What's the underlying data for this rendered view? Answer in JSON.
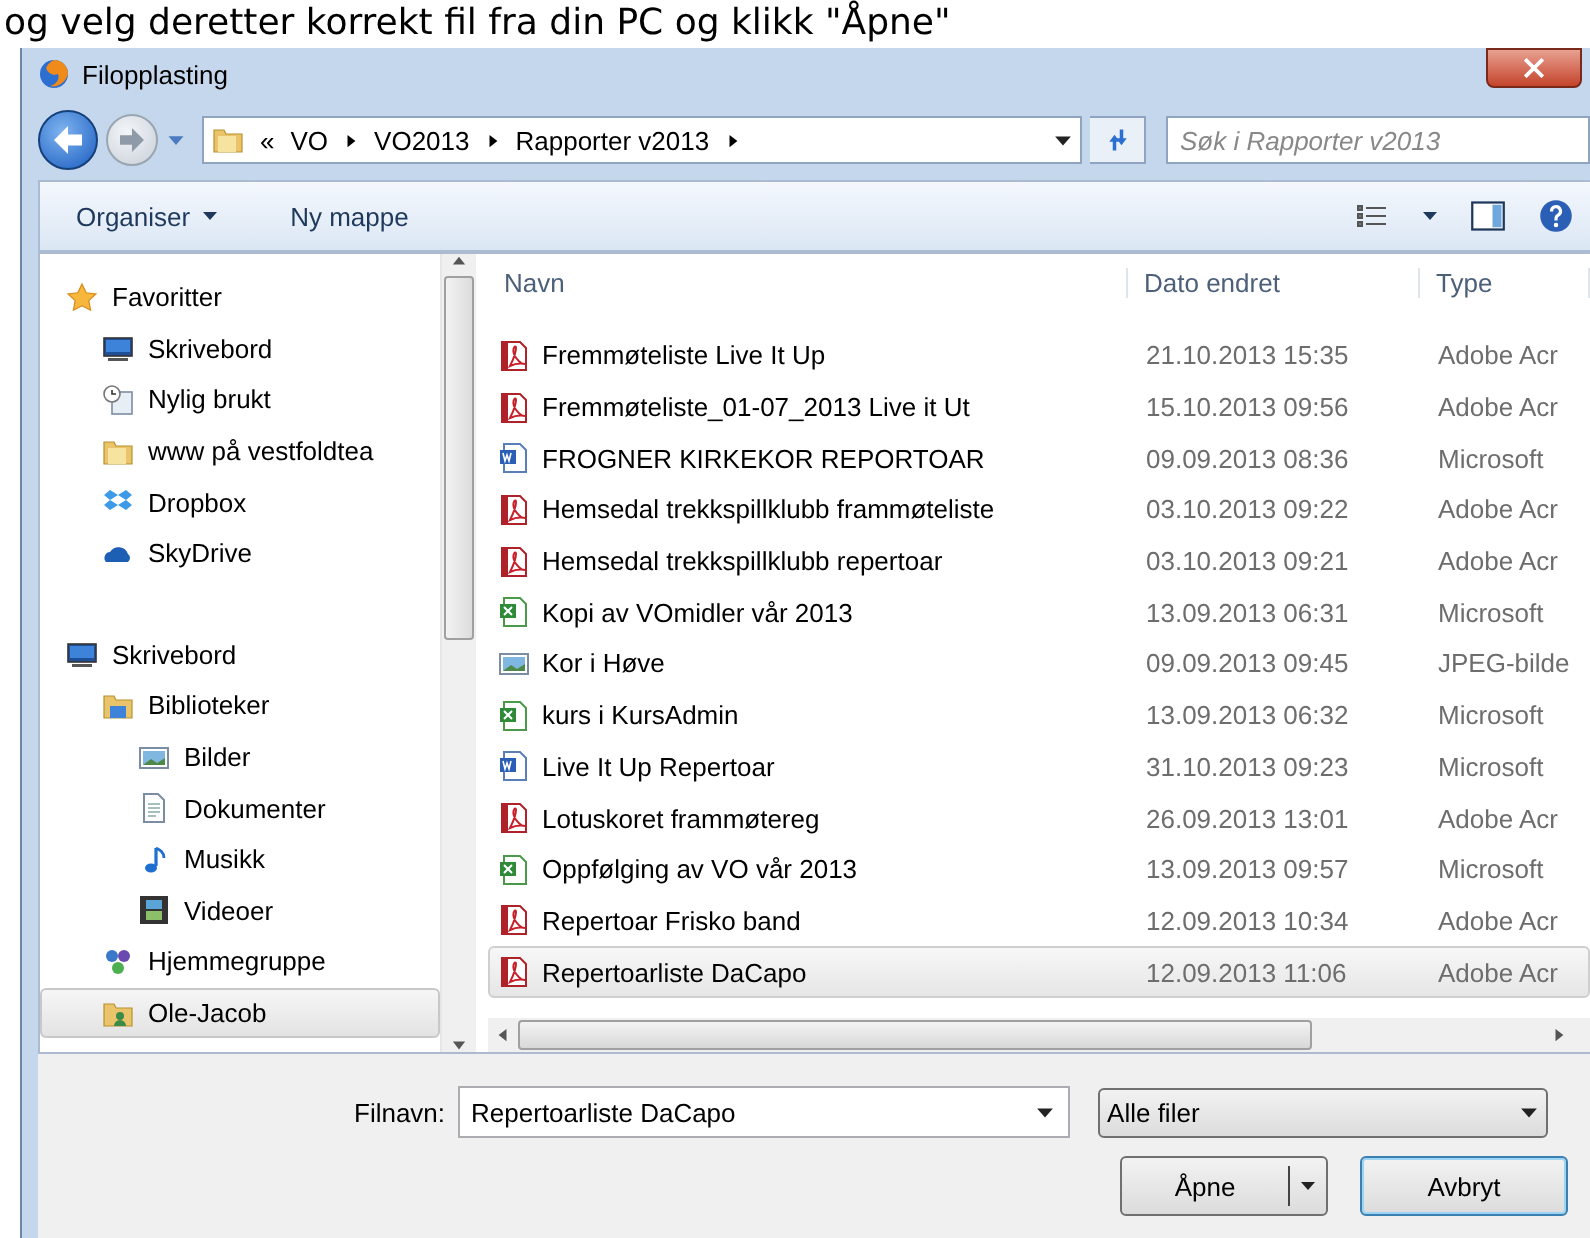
{
  "caption": "og velg deretter korrekt fil fra din PC og klikk \"Åpne\"",
  "window": {
    "title": "Filopplasting"
  },
  "breadcrumb": {
    "overflow": "«",
    "segments": [
      "VO",
      "VO2013",
      "Rapporter v2013"
    ]
  },
  "search": {
    "placeholder": "Søk i Rapporter v2013"
  },
  "toolbar": {
    "organize": "Organiser",
    "new_folder": "Ny mappe"
  },
  "navigation": [
    {
      "label": "Favoritter",
      "kind": "star",
      "selected": false,
      "children": [
        {
          "label": "Skrivebord",
          "kind": "desktop",
          "selected": false
        },
        {
          "label": "Nylig brukt",
          "kind": "recent",
          "selected": false
        },
        {
          "label": "www på vestfoldtea",
          "kind": "folder",
          "selected": false
        },
        {
          "label": "Dropbox",
          "kind": "dropbox",
          "selected": false
        },
        {
          "label": "SkyDrive",
          "kind": "cloud",
          "selected": false
        }
      ]
    },
    {
      "label": "Skrivebord",
      "kind": "desktop",
      "selected": false,
      "children": [
        {
          "label": "Biblioteker",
          "kind": "library",
          "selected": false,
          "children": [
            {
              "label": "Bilder",
              "kind": "image",
              "selected": false
            },
            {
              "label": "Dokumenter",
              "kind": "document",
              "selected": false
            },
            {
              "label": "Musikk",
              "kind": "music",
              "selected": false
            },
            {
              "label": "Videoer",
              "kind": "video",
              "selected": false
            }
          ]
        },
        {
          "label": "Hjemmegruppe",
          "kind": "homegroup",
          "selected": false
        },
        {
          "label": "Ole-Jacob",
          "kind": "user",
          "selected": true
        }
      ]
    }
  ],
  "files": {
    "columns": [
      "Navn",
      "Dato endret",
      "Type"
    ],
    "rows": [
      {
        "name": "Fremmøteliste Live It Up",
        "date": "21.10.2013 15:35",
        "type": "Adobe Acr",
        "kind": "pdf",
        "selected": false
      },
      {
        "name": "Fremmøteliste_01-07_2013 Live it Ut",
        "date": "15.10.2013 09:56",
        "type": "Adobe Acr",
        "kind": "pdf",
        "selected": false
      },
      {
        "name": "FROGNER KIRKEKOR REPORTOAR",
        "date": "09.09.2013 08:36",
        "type": "Microsoft",
        "kind": "word",
        "selected": false
      },
      {
        "name": "Hemsedal trekkspillklubb frammøteliste",
        "date": "03.10.2013 09:22",
        "type": "Adobe Acr",
        "kind": "pdf",
        "selected": false
      },
      {
        "name": "Hemsedal trekkspillklubb repertoar",
        "date": "03.10.2013 09:21",
        "type": "Adobe Acr",
        "kind": "pdf",
        "selected": false
      },
      {
        "name": "Kopi av VOmidler vår 2013",
        "date": "13.09.2013 06:31",
        "type": "Microsoft",
        "kind": "excel",
        "selected": false
      },
      {
        "name": "Kor i Høve",
        "date": "09.09.2013 09:45",
        "type": "JPEG-bilde",
        "kind": "image",
        "selected": false
      },
      {
        "name": "kurs i KursAdmin",
        "date": "13.09.2013 06:32",
        "type": "Microsoft",
        "kind": "excel",
        "selected": false
      },
      {
        "name": "Live It Up Repertoar",
        "date": "31.10.2013 09:23",
        "type": "Microsoft",
        "kind": "word",
        "selected": false
      },
      {
        "name": "Lotuskoret frammøtereg",
        "date": "26.09.2013 13:01",
        "type": "Adobe Acr",
        "kind": "pdf",
        "selected": false
      },
      {
        "name": "Oppfølging av VO vår 2013",
        "date": "13.09.2013 09:57",
        "type": "Microsoft",
        "kind": "excel",
        "selected": false
      },
      {
        "name": "Repertoar Frisko band",
        "date": "12.09.2013 10:34",
        "type": "Adobe Acr",
        "kind": "pdf",
        "selected": false
      },
      {
        "name": "Repertoarliste DaCapo",
        "date": "12.09.2013 11:06",
        "type": "Adobe Acr",
        "kind": "pdf",
        "selected": true
      }
    ]
  },
  "footer": {
    "filename_label": "Filnavn:",
    "filename": "Repertoarliste DaCapo",
    "filter": "Alle filer",
    "open": "Åpne",
    "cancel": "Avbryt"
  }
}
